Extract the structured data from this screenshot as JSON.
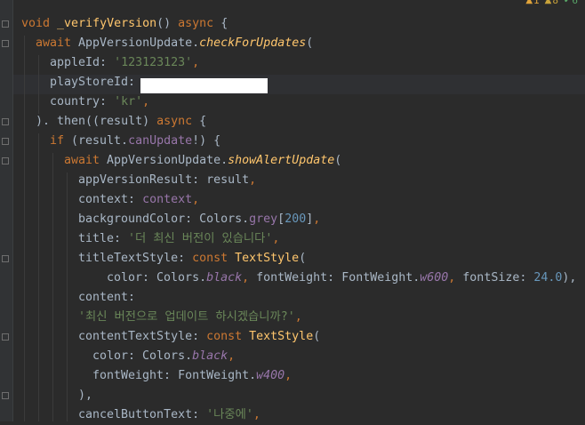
{
  "inspections": {
    "errors": {
      "icon": "error-icon",
      "count": "1"
    },
    "warnings": {
      "icon": "warning-icon",
      "count": "8"
    },
    "weak_warnings": {
      "icon": "check-icon",
      "count": "6"
    }
  },
  "code": {
    "l1": {
      "kw": "void",
      "fn": "_verifyVersion",
      "rest": "() ",
      "kw2": "async",
      "end": " {"
    },
    "l2": {
      "kw": "await",
      "cls": " AppVersionUpdate.",
      "method": "checkForUpdates",
      "end": "("
    },
    "l3": {
      "key": "appleId: ",
      "str": "'123123123'",
      "end": ","
    },
    "l4": {
      "key": "playStoreId: "
    },
    "l5": {
      "key": "country: ",
      "str": "'kr'",
      "end": ","
    },
    "l6": {
      "pre": "). then((result) ",
      "kw": "async",
      "end": " {"
    },
    "l7": {
      "kw": "if",
      "mid": " (result.",
      "prop": "canUpdate",
      "end": "!) {"
    },
    "l8": {
      "kw": "await",
      "cls": " AppVersionUpdate.",
      "method": "showAlertUpdate",
      "end": "("
    },
    "l9": {
      "key": "appVersionResult: result",
      "end": ","
    },
    "l10": {
      "key": "context: ",
      "val": "context",
      "end": ","
    },
    "l11": {
      "key": "backgroundColor: Colors.",
      "prop": "grey",
      "br1": "[",
      "num": "200",
      "br2": "]",
      "end": ","
    },
    "l12": {
      "key": "title: ",
      "str": "'더 최신 버전이 있습니다'",
      "end": ","
    },
    "l13": {
      "key": "titleTextStyle: ",
      "kw": "const",
      "cls": " TextStyle",
      "end": "("
    },
    "l14": {
      "k1": "color: Colors.",
      "v1": "black",
      "c1": ", ",
      "k2": "fontWeight: FontWeight.",
      "v2": "w600",
      "c2": ", ",
      "k3": "fontSize: ",
      "num": "24.0",
      "end": "),"
    },
    "l15": {
      "key": "content: "
    },
    "l16": {
      "str": "'최신 버전으로 업데이트 하시겠습니까?'",
      "end": ","
    },
    "l17": {
      "key": "contentTextStyle: ",
      "kw": "const",
      "cls": " TextStyle",
      "end": "("
    },
    "l18": {
      "key": "color: Colors.",
      "val": "black",
      "end": ","
    },
    "l19": {
      "key": "fontWeight: FontWeight.",
      "val": "w400",
      "end": ","
    },
    "l20": {
      "pre": "),"
    },
    "l21": {
      "key": "cancelButtonText: ",
      "str": "'나중에'",
      "end": ","
    }
  },
  "colors": {
    "background": "#2b2b2b",
    "keyword": "#cc7832",
    "function": "#ffc66d",
    "string": "#6a8759",
    "number": "#6897bb",
    "field": "#9876aa",
    "text": "#a9b7c6"
  }
}
